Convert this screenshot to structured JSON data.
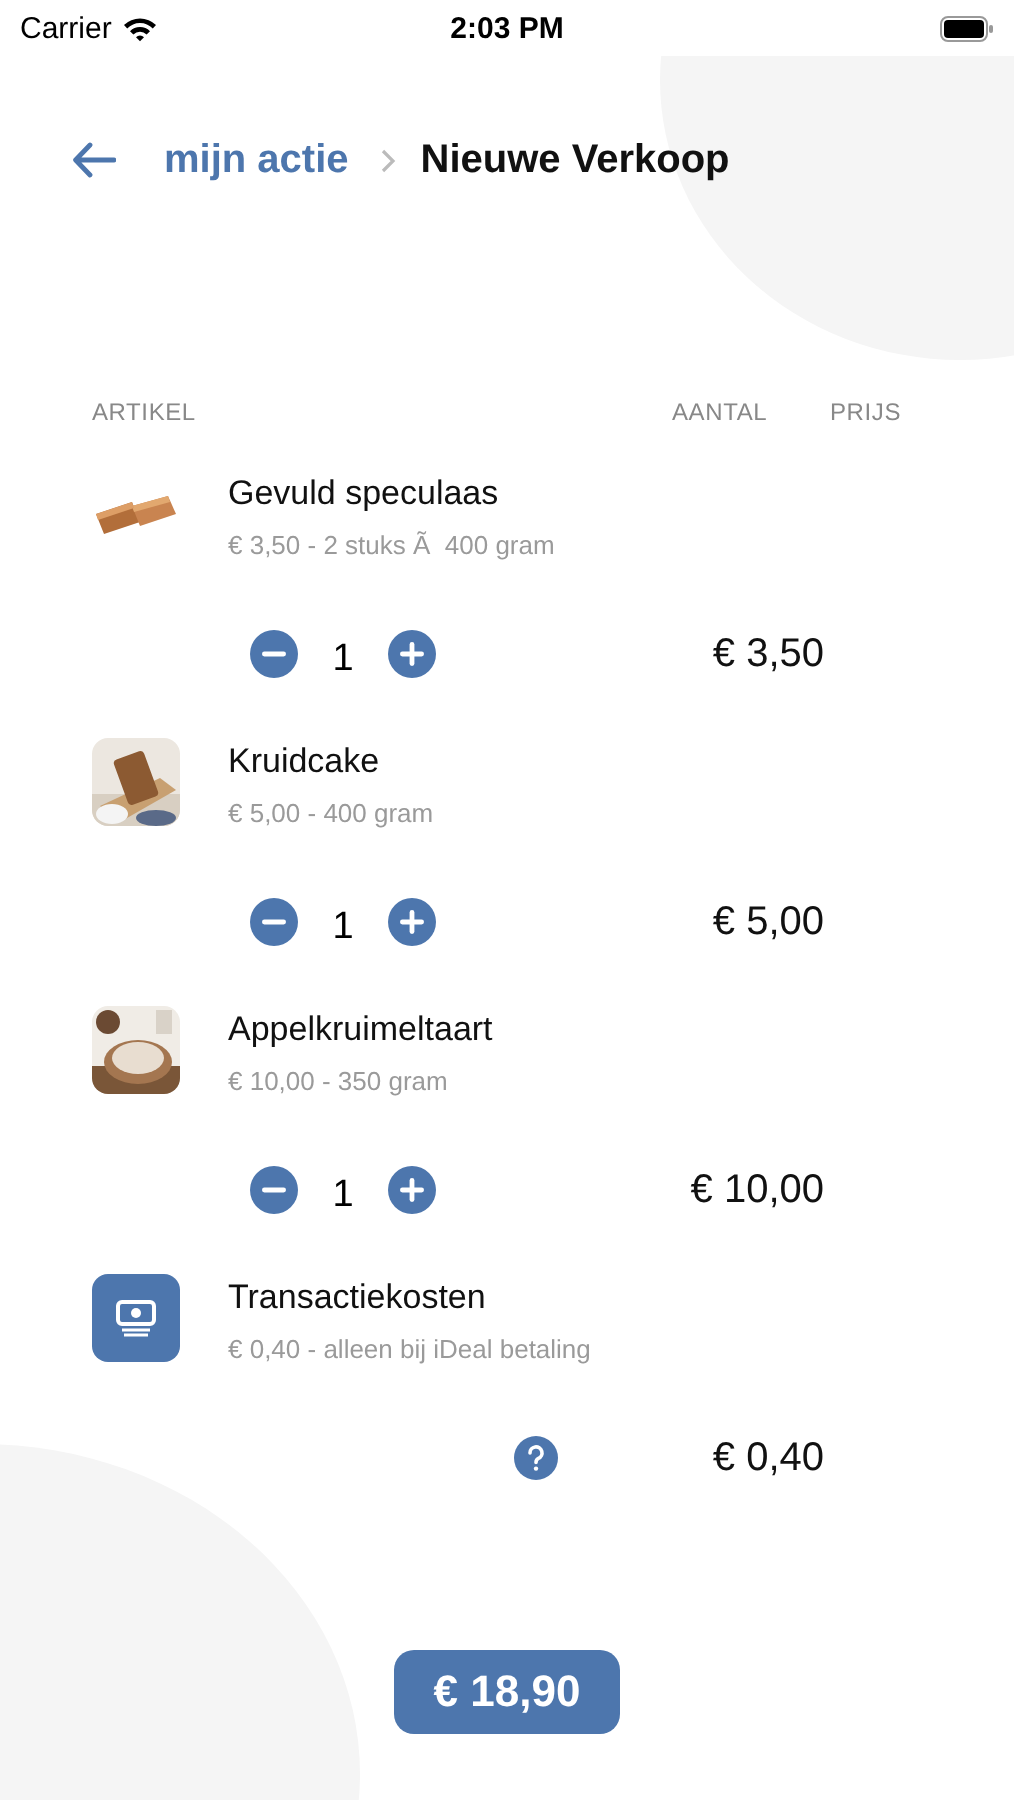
{
  "status_bar": {
    "carrier": "Carrier",
    "time": "2:03 PM"
  },
  "header": {
    "back_link": "mijn actie",
    "title": "Nieuwe Verkoop"
  },
  "columns": [
    "ARTIKEL",
    "AANTAL",
    "PRIJS"
  ],
  "items": [
    {
      "kind": "product",
      "name": "Gevuld speculaas",
      "details": "€ 3,50 - 2 stuks Ã  400 gram",
      "quantity": "1",
      "price": "€ 3,50"
    },
    {
      "kind": "product",
      "name": "Kruidcake",
      "details": "€ 5,00 - 400 gram",
      "quantity": "1",
      "price": "€ 5,00"
    },
    {
      "kind": "product",
      "name": "Appelkruimeltaart",
      "details": "€ 10,00 - 350 gram",
      "quantity": "1",
      "price": "€ 10,00"
    },
    {
      "kind": "fee",
      "name": "Transactiekosten",
      "details": "€ 0,40 - alleen bij iDeal betaling",
      "price": "€ 0,40"
    }
  ],
  "total": "€ 18,90"
}
